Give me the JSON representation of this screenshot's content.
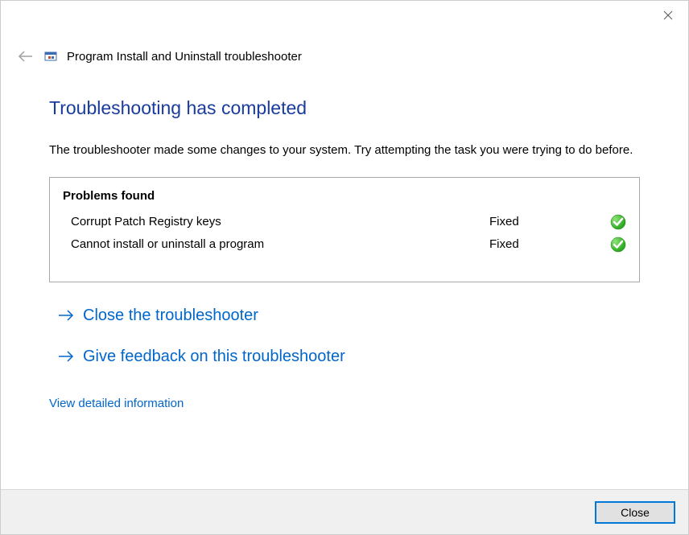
{
  "window": {
    "app_title": "Program Install and Uninstall troubleshooter"
  },
  "main": {
    "heading": "Troubleshooting has completed",
    "description": "The troubleshooter made some changes to your system. Try attempting the task you were trying to do before."
  },
  "problems": {
    "header": "Problems found",
    "items": [
      {
        "name": "Corrupt Patch Registry keys",
        "status": "Fixed"
      },
      {
        "name": "Cannot install or uninstall a program",
        "status": "Fixed"
      }
    ]
  },
  "actions": {
    "close_troubleshooter": "Close the troubleshooter",
    "give_feedback": "Give feedback on this troubleshooter",
    "view_details": "View detailed information"
  },
  "footer": {
    "close_label": "Close"
  }
}
